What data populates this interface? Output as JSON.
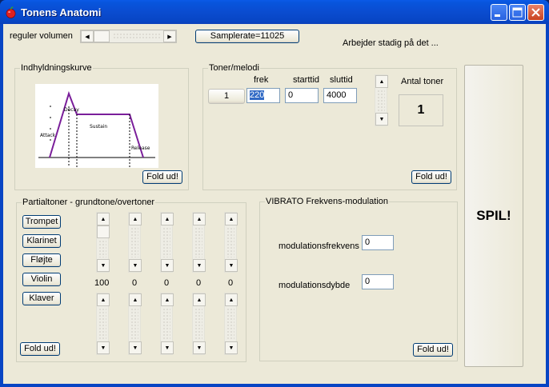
{
  "window": {
    "title": "Tonens Anatomi"
  },
  "top": {
    "volume_label": "reguler volumen",
    "samplerate_button": "Samplerate=11025",
    "status": "Arbejder stadig på det ..."
  },
  "envelope": {
    "group_title": "Indhyldningskurve",
    "labels": [
      "Attack",
      "Decay",
      "Sustain",
      "Release"
    ],
    "fold_button": "Fold ud!"
  },
  "tones": {
    "group_title": "Toner/melodi",
    "headers": {
      "freq": "frek",
      "start": "starttid",
      "end": "sluttid"
    },
    "row_index": "1",
    "freq_value": "220",
    "start_value": "0",
    "end_value": "4000",
    "count_label": "Antal toner",
    "count_value": "1",
    "fold_button": "Fold ud!"
  },
  "partials": {
    "group_title": "Partialtoner - grundtone/overtoner",
    "instruments": [
      "Trompet",
      "Klarinet",
      "Fløjte",
      "Violin",
      "Klaver"
    ],
    "values": [
      "100",
      "0",
      "0",
      "0",
      "0"
    ],
    "fold_button": "Fold ud!"
  },
  "vibrato": {
    "group_title": "VIBRATO  Frekvens-modulation",
    "freq_label": "modulationsfrekvens",
    "freq_value": "0",
    "depth_label": "modulationsdybde",
    "depth_value": "0",
    "fold_button": "Fold ud!"
  },
  "play_button": "SPIL!"
}
